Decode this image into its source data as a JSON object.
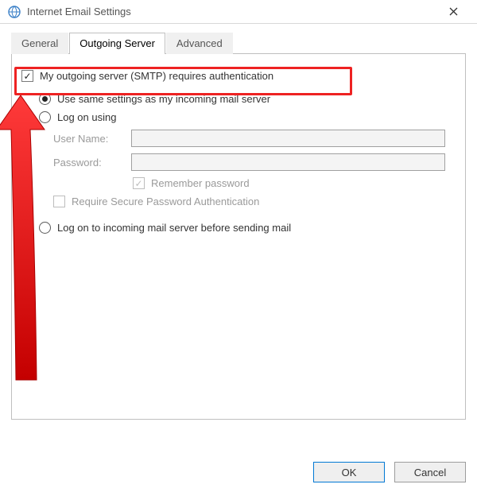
{
  "window": {
    "title": "Internet Email Settings"
  },
  "tabs": {
    "general": "General",
    "outgoing": "Outgoing Server",
    "advanced": "Advanced"
  },
  "form": {
    "requires_auth_label": "My outgoing server (SMTP) requires authentication",
    "use_same_label": "Use same settings as my incoming mail server",
    "log_on_using_label": "Log on using",
    "username_label": "User Name:",
    "username_value": "",
    "password_label": "Password:",
    "password_value": "",
    "remember_password_label": "Remember password",
    "require_spa_label": "Require Secure Password Authentication",
    "log_on_incoming_label": "Log on to incoming mail server before sending mail"
  },
  "buttons": {
    "ok": "OK",
    "cancel": "Cancel"
  }
}
